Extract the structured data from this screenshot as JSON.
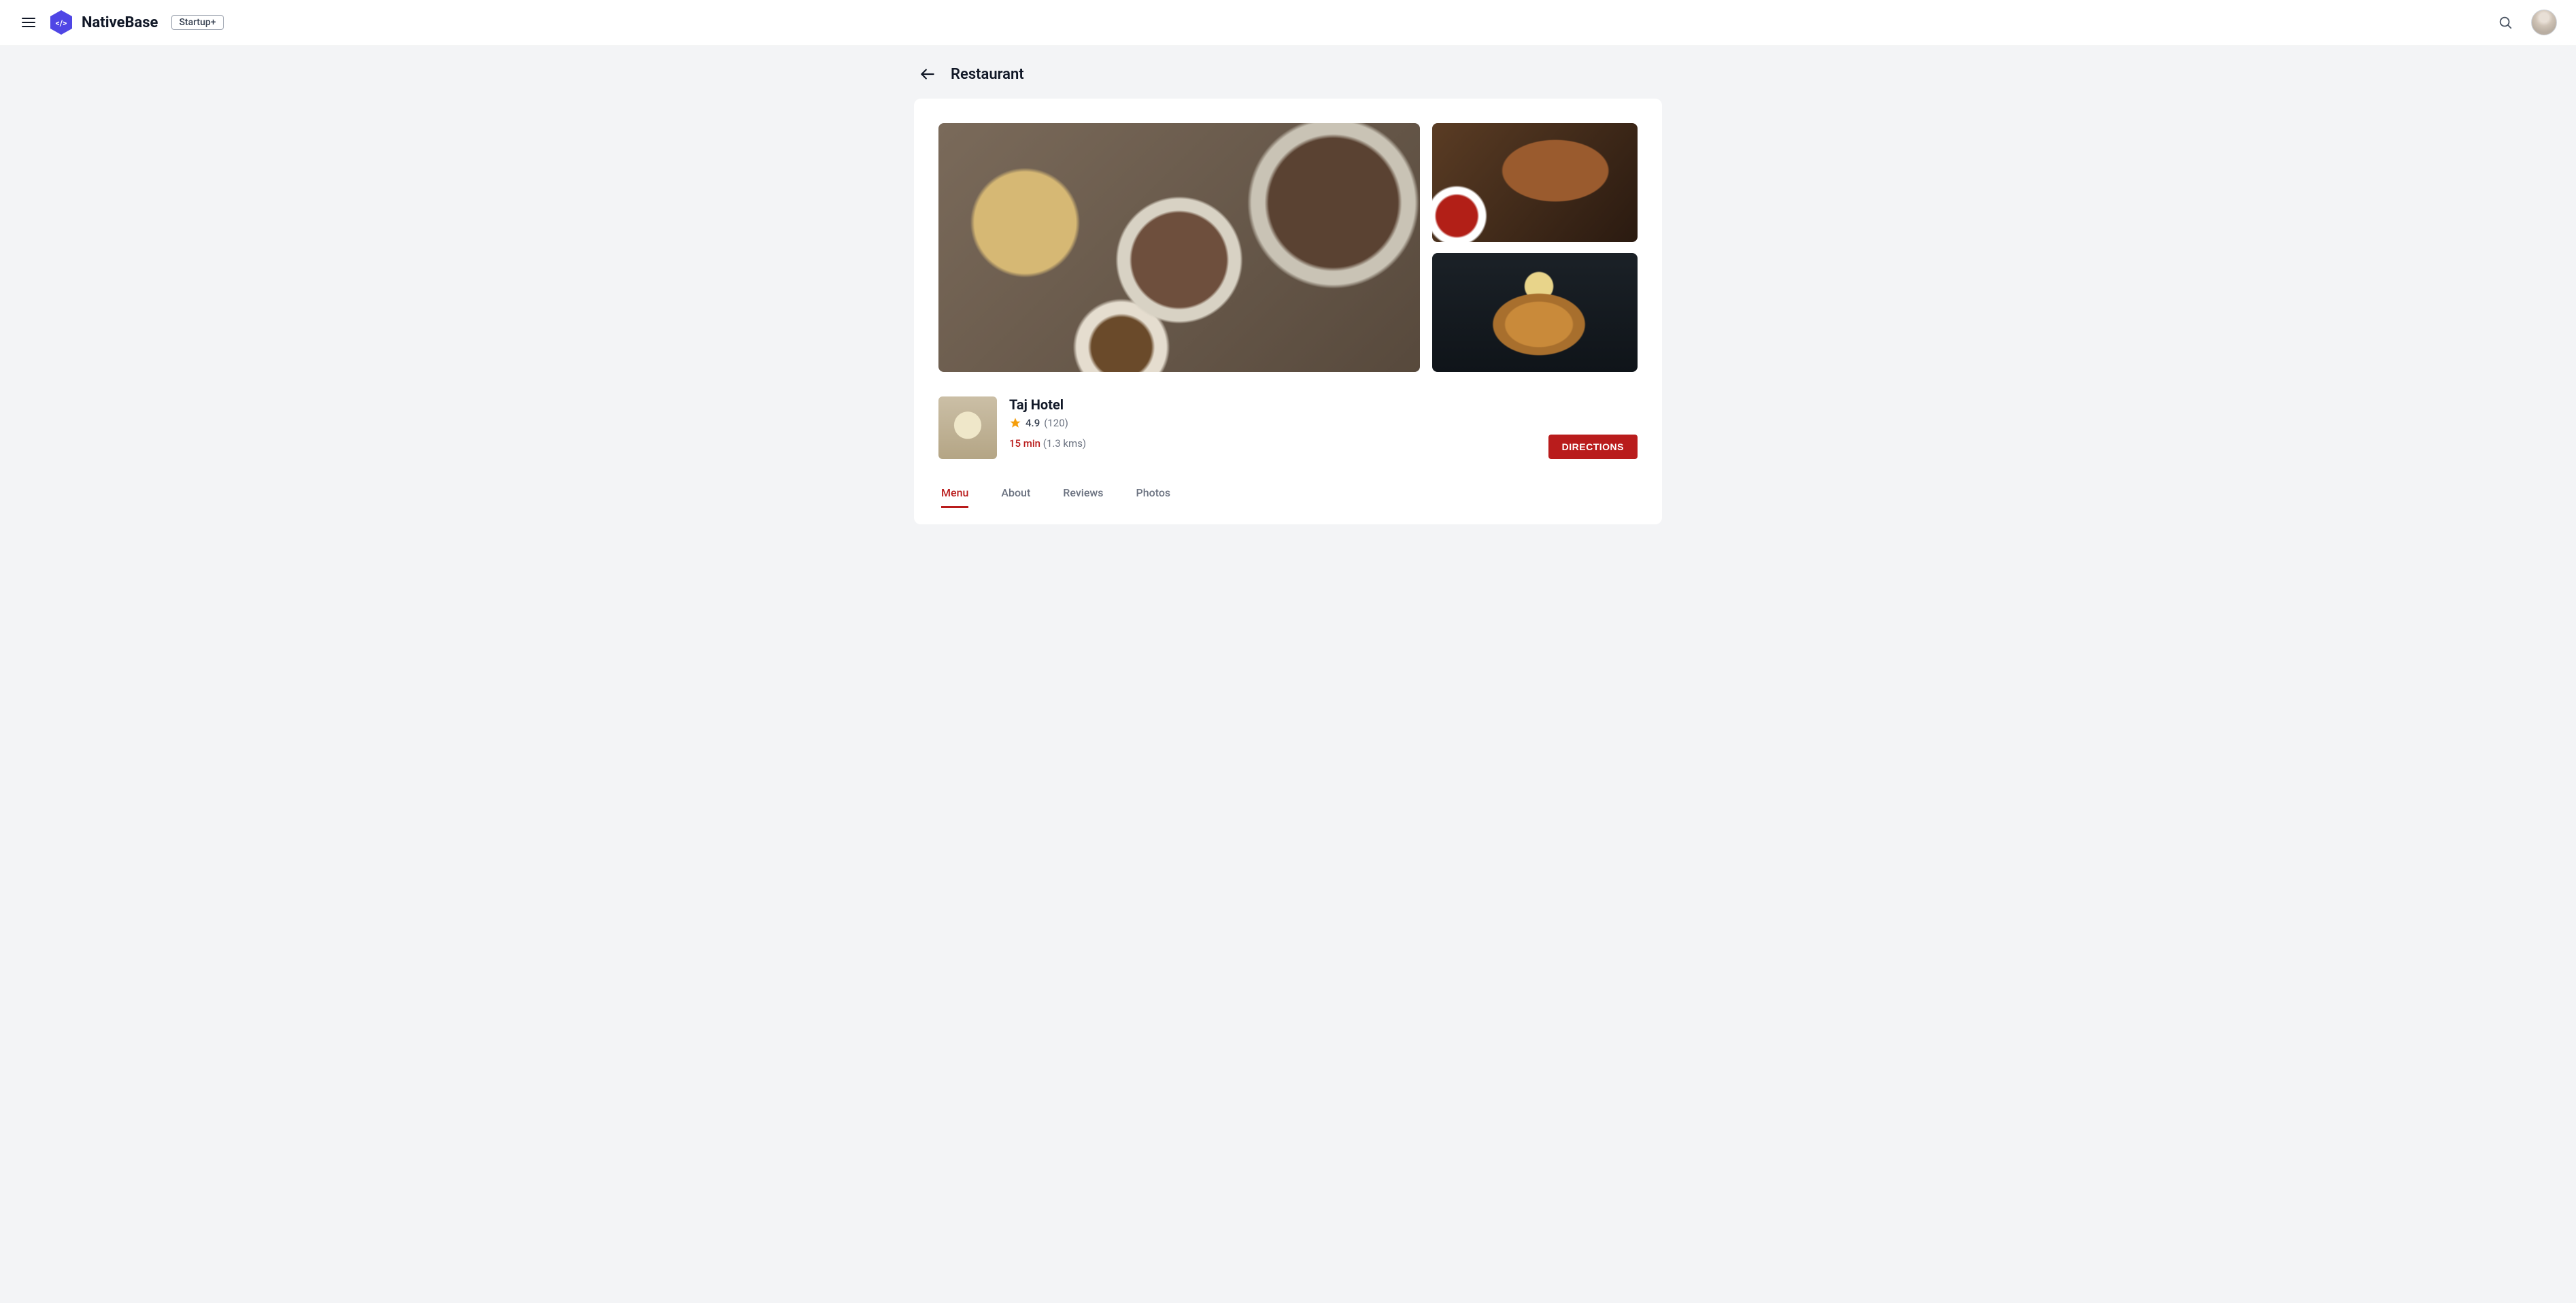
{
  "header": {
    "brand": "NativeBase",
    "chip": "Startup+"
  },
  "page": {
    "title": "Restaurant"
  },
  "hotel": {
    "name": "Taj Hotel",
    "rating": "4.9",
    "ratingCount": "(120)",
    "time": "15 min",
    "distance": "(1.3 kms)",
    "directionsLabel": "DIRECTIONS"
  },
  "tabs": [
    {
      "label": "Menu"
    },
    {
      "label": "About"
    },
    {
      "label": "Reviews"
    },
    {
      "label": "Photos"
    }
  ]
}
